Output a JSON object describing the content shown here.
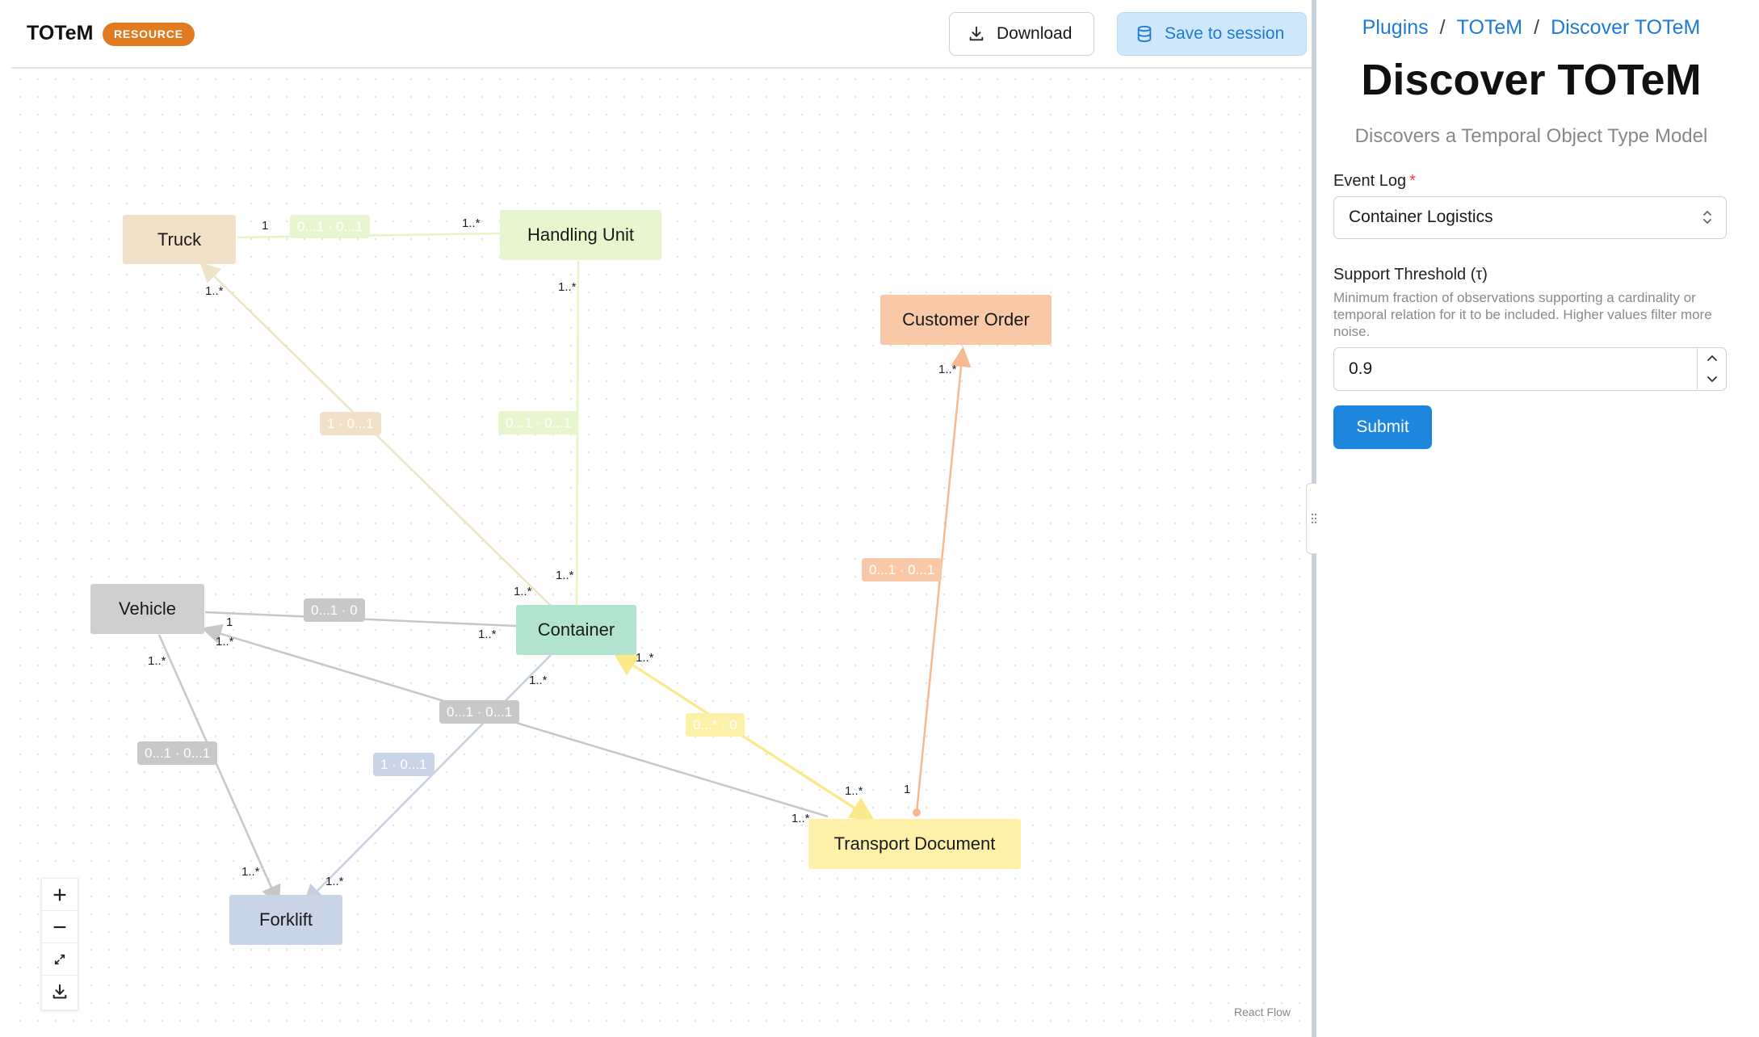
{
  "app": {
    "title": "TOTeM",
    "badge": "RESOURCE",
    "download_label": "Download",
    "save_session_label": "Save to session"
  },
  "graph": {
    "nodes": {
      "truck": {
        "label": "Truck",
        "color": "#f1e1c9"
      },
      "handling_unit": {
        "label": "Handling Unit",
        "color": "#e7f6cf"
      },
      "customer_order": {
        "label": "Customer Order",
        "color": "#f9c9a7"
      },
      "vehicle": {
        "label": "Vehicle",
        "color": "#cfcfcf"
      },
      "container": {
        "label": "Container",
        "color": "#b2e3cf"
      },
      "transport_document": {
        "label": "Transport Document",
        "color": "#fdf0a8"
      },
      "forklift": {
        "label": "Forklift",
        "color": "#c9d4e6"
      }
    },
    "edge_labels": {
      "truck_hu": "0...1 · 0...1",
      "truck_container": "1 · 0...1",
      "hu_container": "0...1 · 0...1",
      "order_doc": "0...1 · 0...1",
      "vehicle_container": "0...1 · 0",
      "vehicle_forklift": "0...1 · 0...1",
      "container_forklift": "1 · 0...1",
      "vehicle_doc": "0...1 · 0...1",
      "container_doc": "0...* · 0"
    },
    "cardinalities": {
      "truck_hu_truck": "1",
      "truck_hu_hu": "1..*",
      "truck_container_truck": "1..*",
      "truck_container_container": "1..*",
      "hu_container_hu": "1..*",
      "hu_container_container": "1..*",
      "order_doc_order": "1..*",
      "order_doc_doc": "1",
      "vehicle_container_vehicle": "1",
      "vehicle_container_container": "1..*",
      "vehicle_doc_vehicle": "1..*",
      "vehicle_doc_doc": "1..*",
      "vehicle_forklift_vehicle": "1..*",
      "vehicle_forklift_forklift": "1..*",
      "container_forklift_container": "1..*",
      "container_forklift_forklift": "1..*",
      "container_doc_container": "1..*",
      "container_doc_doc": "1..*"
    },
    "edge_colors": {
      "truck": "#efe3c7",
      "hu": "#e6f4c6",
      "order": "#f7b98f",
      "vehicle": "#c7c7c7",
      "container_forklift": "#c4cfe2",
      "container_doc": "#fbe98a"
    },
    "label_colors": {
      "truck": "#f1e1c9",
      "hu": "#e7f6cf",
      "order": "#f9c9a7",
      "vehicle": "#c8c8c8",
      "forklift": "#c9d4e6",
      "doc": "#fdf0a8"
    },
    "attribution": "React Flow",
    "controls": [
      "zoom-in",
      "zoom-out",
      "fit-view",
      "download"
    ]
  },
  "panel": {
    "breadcrumb": [
      "Plugins",
      "TOTeM",
      "Discover TOTeM"
    ],
    "title": "Discover TOTeM",
    "subtitle": "Discovers a Temporal Object Type Model",
    "event_log": {
      "label": "Event Log",
      "required_mark": "*",
      "value": "Container Logistics"
    },
    "support_threshold": {
      "label": "Support Threshold (τ)",
      "help": "Minimum fraction of observations supporting a cardinality or temporal relation for it to be included. Higher values filter more noise.",
      "value": "0.9"
    },
    "submit_label": "Submit"
  }
}
